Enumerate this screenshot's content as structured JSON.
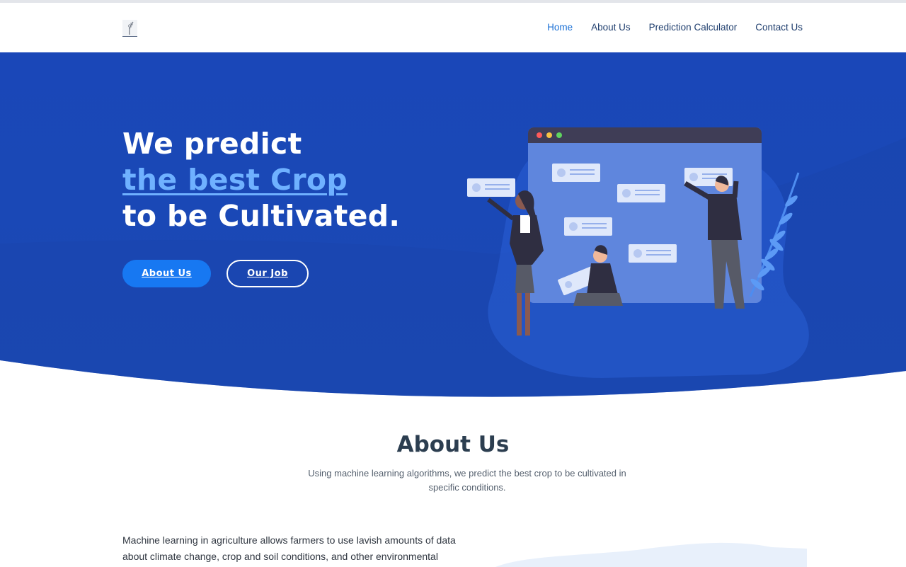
{
  "nav": {
    "logo_icon": "wheat-logo-icon",
    "items": [
      {
        "label": "Home",
        "active": true
      },
      {
        "label": "About Us",
        "active": false
      },
      {
        "label": "Prediction Calculator",
        "active": false
      },
      {
        "label": "Contact Us",
        "active": false
      }
    ]
  },
  "hero": {
    "line1": "We predict",
    "line2": "the best Crop",
    "line3": "to be Cultivated.",
    "primary_button": "About Us",
    "secondary_button": "Our Job",
    "colors": {
      "background": "#1a47b8",
      "highlight": "#6fb1ff",
      "button": "#1778f2"
    }
  },
  "about": {
    "title": "About Us",
    "subtitle": "Using machine learning algorithms, we predict the best crop to be cultivated in specific conditions.",
    "body": "Machine learning in agriculture allows farmers to use lavish amounts of data about climate change, crop and soil conditions, and other environmental"
  }
}
